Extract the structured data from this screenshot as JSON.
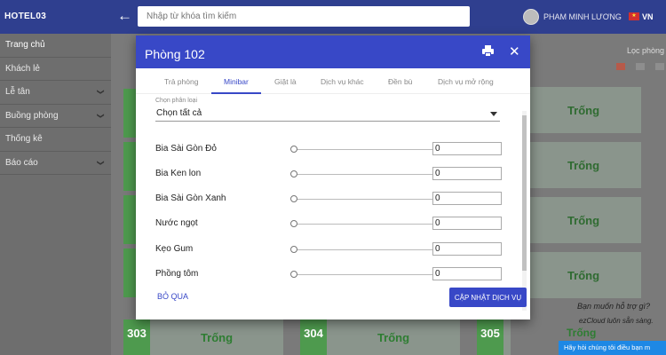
{
  "topbar": {
    "brand": "HOTEL03",
    "back_icon": "arrow-left-icon",
    "search_placeholder": "Nhập từ khóa tìm kiếm",
    "user_name": "PHAM MINH LƯƠNG",
    "language": "VN",
    "flag_star": "★"
  },
  "sidebar": {
    "items": [
      {
        "label": "Trang chủ",
        "chevron": ""
      },
      {
        "label": "Khách lẻ",
        "chevron": ""
      },
      {
        "label": "Lễ tân",
        "chevron": "❯"
      },
      {
        "label": "Buồng phòng",
        "chevron": "❯"
      },
      {
        "label": "Thống kê",
        "chevron": ""
      },
      {
        "label": "Báo cáo",
        "chevron": "❯"
      }
    ]
  },
  "background": {
    "filter_label": "Lọc phòng",
    "status_empty": "Trống",
    "rooms_bottom": [
      {
        "number": "303",
        "status": "Trống"
      },
      {
        "number": "304",
        "status": "Trống"
      },
      {
        "number": "305",
        "status": "Trống"
      }
    ],
    "help_title": "Bạn muốn hỗ trợ gì?",
    "help_sub": "ezCloud luôn sẵn sàng.",
    "chat_label": "Hãy hỏi chúng tôi điều bạn m"
  },
  "modal": {
    "title": "Phòng 102",
    "print_icon": "print-icon",
    "close_icon": "✕",
    "tabs": [
      "Trả phòng",
      "Minibar",
      "Giặt là",
      "Dịch vụ khác",
      "Đền bù",
      "Dịch vụ mở rộng"
    ],
    "active_tab": "Minibar",
    "category_label": "Chọn phân loại",
    "category_value": "Chọn tất cả",
    "items": [
      {
        "name": "Bia Sài Gòn Đỏ",
        "qty": "0"
      },
      {
        "name": "Bia Ken lon",
        "qty": "0"
      },
      {
        "name": "Bia Sài Gòn Xanh",
        "qty": "0"
      },
      {
        "name": "Nước ngọt",
        "qty": "0"
      },
      {
        "name": "Kẹo Gum",
        "qty": "0"
      },
      {
        "name": "Phồng tôm",
        "qty": "0"
      }
    ],
    "skip_label": "BỎ QUA",
    "update_label": "CẬP NHẬT DỊCH VỤ"
  },
  "colors": {
    "primary": "#3848c7",
    "room_green": "#4e9a4e",
    "status_green": "#2e7d32"
  }
}
